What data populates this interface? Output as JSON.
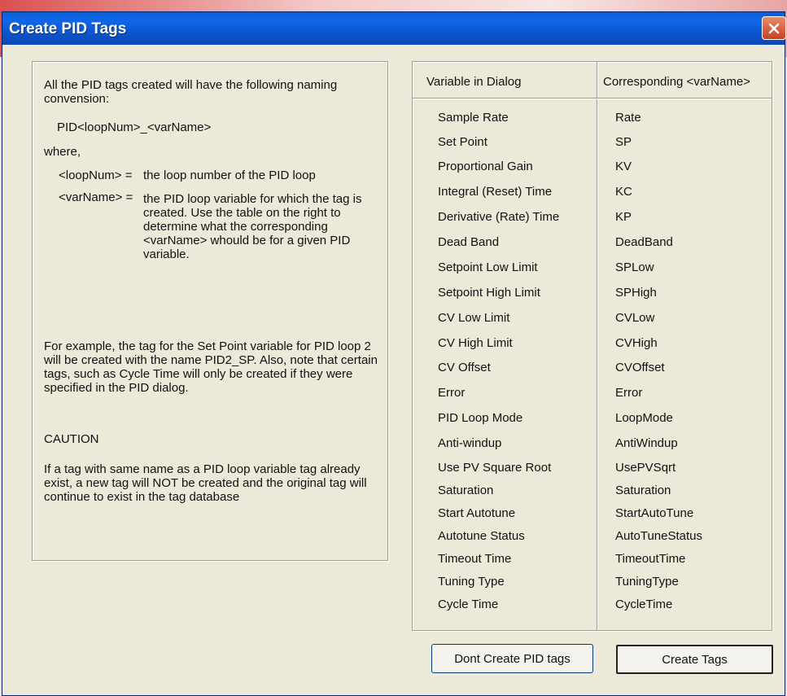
{
  "window": {
    "title": "Create PID Tags"
  },
  "info": {
    "intro": "All the PID tags created will have the following naming convension:",
    "pattern": "PID<loopNum>_<varName>",
    "where": "where,",
    "loop_key": "<loopNum> =",
    "loop_desc": "the loop number of the PID loop",
    "var_key": "<varName> =",
    "var_desc": "the PID loop variable for which the tag is created. Use the table on the right to determine what the corresponding <varName> whould be for a given PID variable.",
    "example": "For example, the tag for the Set Point variable for PID loop 2 will be created with the name PID2_SP. Also, note that certain tags, such as Cycle Time will only be created if they were specified in the PID dialog.",
    "caution_title": "CAUTION",
    "caution_text": "If a tag with same name as a PID loop variable tag already exist, a new tag will NOT be created and the original tag will continue to exist in the tag database"
  },
  "table": {
    "headers": [
      "Variable in Dialog",
      "Corresponding <varName>"
    ],
    "rows": [
      [
        "Sample Rate",
        "Rate"
      ],
      [
        "Set Point",
        "SP"
      ],
      [
        "Proportional Gain",
        "KV"
      ],
      [
        "Integral (Reset) Time",
        "KC"
      ],
      [
        "Derivative (Rate) Time",
        "KP"
      ],
      [
        "Dead Band",
        "DeadBand"
      ],
      [
        "Setpoint Low Limit",
        "SPLow"
      ],
      [
        "Setpoint High Limit",
        "SPHigh"
      ],
      [
        "CV Low Limit",
        "CVLow"
      ],
      [
        "CV High Limit",
        "CVHigh"
      ],
      [
        "CV Offset",
        "CVOffset"
      ],
      [
        "Error",
        "Error"
      ],
      [
        "PID Loop Mode",
        "LoopMode"
      ],
      [
        "Anti-windup",
        "AntiWindup"
      ],
      [
        "Use PV Square Root",
        "UsePVSqrt"
      ],
      [
        "Saturation",
        "Saturation"
      ],
      [
        "Start Autotune",
        "StartAutoTune"
      ],
      [
        "Autotune Status",
        "AutoTuneStatus"
      ],
      [
        "Timeout Time",
        "TimeoutTime"
      ],
      [
        "Tuning Type",
        "TuningType"
      ],
      [
        "Cycle Time",
        "CycleTime"
      ]
    ]
  },
  "buttons": {
    "dont_create": "Dont Create PID tags",
    "create": "Create Tags"
  },
  "icons": {
    "close": "close-icon"
  },
  "colors": {
    "titlebar": "#0b53c8",
    "close": "#d9512c",
    "dialog": "#ece9d8"
  }
}
